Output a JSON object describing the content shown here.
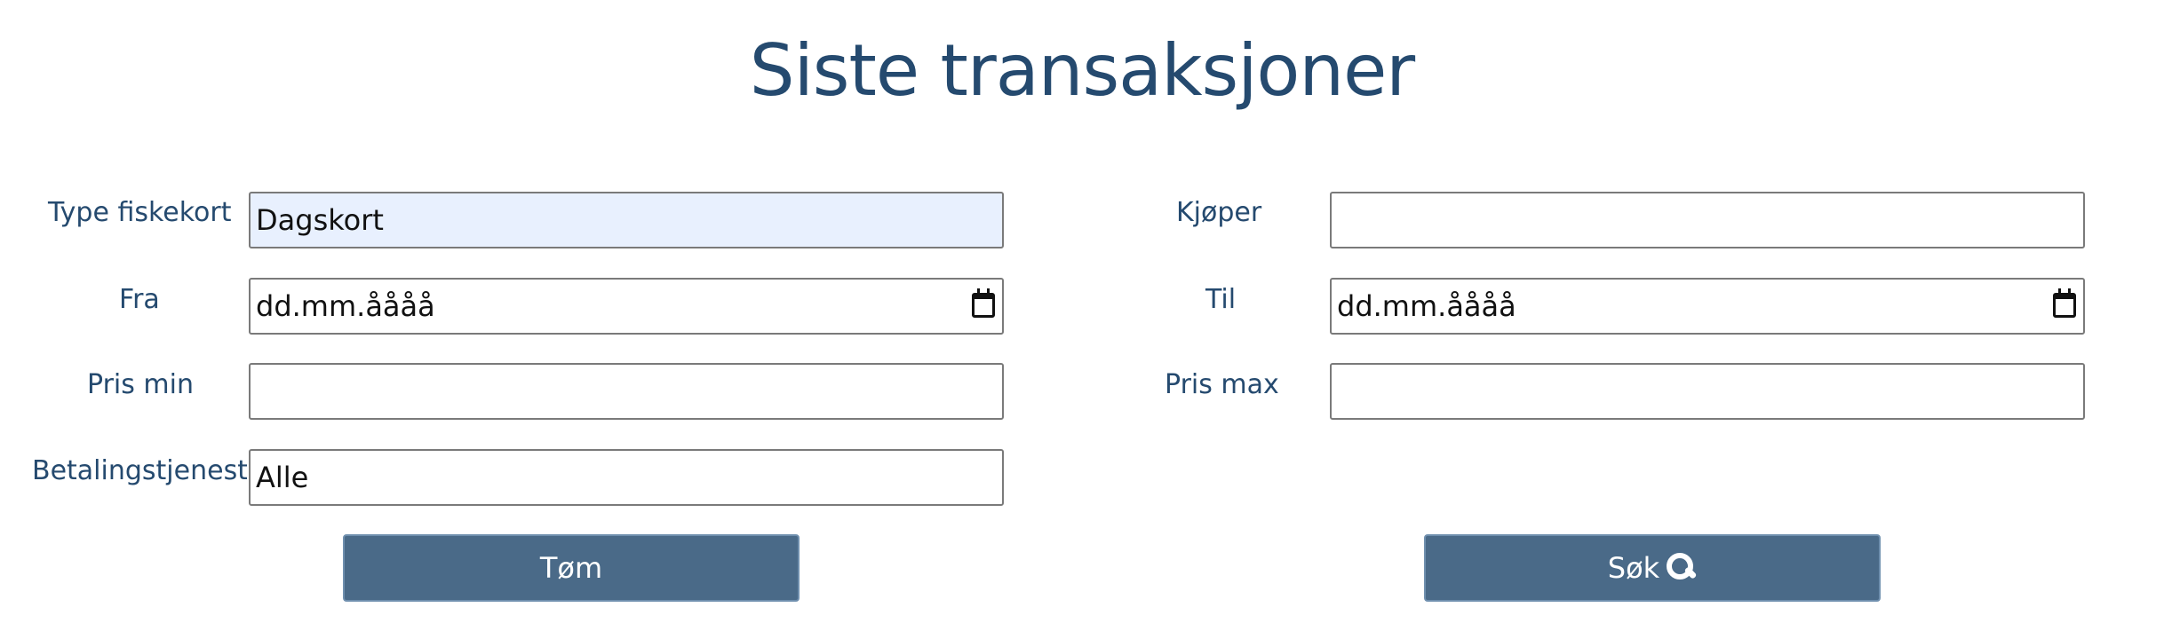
{
  "page": {
    "title": "Siste transaksjoner"
  },
  "form": {
    "type_label": "Type fiskekort",
    "type_value": "Dagskort",
    "buyer_label": "Kjøper",
    "buyer_value": "",
    "from_label": "Fra",
    "from_value": "dd.mm.åååå",
    "to_label": "Til",
    "to_value": "dd.mm.åååå",
    "price_min_label": "Pris min",
    "price_min_value": "",
    "price_max_label": "Pris max",
    "price_max_value": "",
    "payment_label": "Betalingstjeneste",
    "payment_value": "Alle"
  },
  "buttons": {
    "clear_label": "Tøm",
    "search_label": "Søk"
  },
  "icons": {
    "calendar": "calendar-icon",
    "search": "search-icon"
  },
  "colors": {
    "heading": "#254a6f",
    "button": "#4a6a88",
    "autofill": "#e8f0fe"
  }
}
